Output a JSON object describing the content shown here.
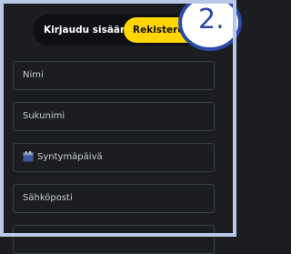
{
  "tabs": {
    "login_label": "Kirjaudu sisään",
    "register_label": "Rekisteröidy"
  },
  "step_badge": "2.",
  "form": {
    "first_name_placeholder": "Nimi",
    "last_name_placeholder": "Sukunimi",
    "birthdate_placeholder": "Syntymäpäivä",
    "email_placeholder": "Sähköposti"
  },
  "colors": {
    "accent": "#ffd600",
    "background": "#1b1d21",
    "badge": "#2c4aa8"
  }
}
